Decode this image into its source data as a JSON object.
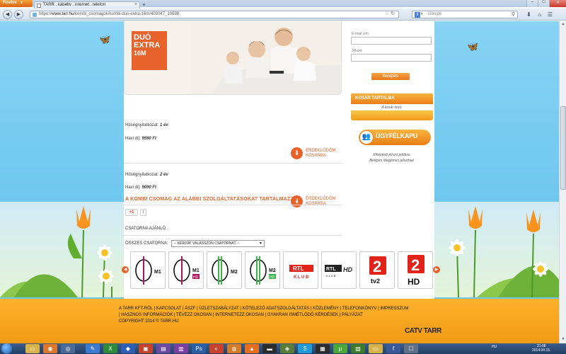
{
  "browser": {
    "menu_label": "Firefox",
    "tab_title": "TARR . kábeltv . internet . telefon",
    "url_host": "www.tarr.hu",
    "url_prefix": "https://",
    "url_path": "/kombi_csomagok/kombi-duo-extra-16m/400047_10598",
    "search_placeholder": "Google"
  },
  "hero": {
    "badge_line1": "DUÓ",
    "badge_line2": "EXTRA",
    "badge_line3": "16M"
  },
  "offers": [
    {
      "commitment_label": "Hűségnyilatkozat:",
      "commitment_value": "1 év",
      "fee_label": "Havi díj:",
      "fee_value": "9590 Ft",
      "cta_line1": "ÉRDEKLŐDÖM",
      "cta_line2": "KOSÁRBA"
    },
    {
      "commitment_label": "Hűségnyilatkozat:",
      "commitment_value": "2 év",
      "fee_label": "Havi díj:",
      "fee_value": "9090 Ft",
      "cta_line1": "ÉRDEKLŐDÖM",
      "cta_line2": "KOSÁRBA"
    }
  ],
  "login": {
    "email_label": "E-mail cím:",
    "password_label": "Jelszó:",
    "submit_label": "Belépés"
  },
  "cart": {
    "title": "KOSÁR TARTALMA",
    "empty_text": "A kosár üres."
  },
  "customer_portal": {
    "label": "ÜGYFÉLKAPU",
    "note_line1": "Elfelejtett jelszó pótlása",
    "note_line2": "Belépés ideiglenes jelszóval"
  },
  "package": {
    "section_title": "A KOMBI CSOMAG AZ ALÁBBI SZOLGÁLTATÁSOKAT TARTALMAZZA",
    "gplus_label": "+1",
    "gplus_count": "1",
    "channel_recommend": "CSATORNA AJÁNLÓ",
    "all_channels_label": "ÖSSZES CSATORNA:",
    "channel_select_value": "-- KÉRJÜK VÁLASSZON CSATORNÁT --"
  },
  "channels": [
    {
      "name": "M1",
      "badge": "",
      "color": "#b0125b"
    },
    {
      "name": "M1",
      "badge": "HD",
      "color": "#b0125b"
    },
    {
      "name": "M2",
      "badge": "",
      "color": "#3bb54a"
    },
    {
      "name": "M2",
      "badge": "HD",
      "color": "#3bb54a"
    },
    {
      "name": "RTL",
      "badge": "KLUB",
      "color": "#e2231a"
    },
    {
      "name": "RTL",
      "badge": "HD",
      "color": "#222222"
    },
    {
      "name": "tv2",
      "badge": "",
      "color": "#e2231a"
    },
    {
      "name": "2",
      "badge": "HD",
      "color": "#e2231a"
    }
  ],
  "footer": {
    "line1": "A TARR KFT-RŐL | KAPCSOLAT | ÁSZF | ÜZLETSZABÁLYZAT | KÖTELEZŐ ADATSZOLGÁLTATÁS | KÖZLEMÉNY | TELEFONKÖNYV | IMPRESSZUM",
    "line2": "| HASZNOS INFORMÁCIÓK | TÉVÉZZ OKOSAN | INTERNETEZZ OKOSAN | GYAKRAN ISMÉTLŐDŐ KÉRDÉSEK | PÁLYÁZAT",
    "copyright": "COPYRIGHT 2014 © TARR.HU",
    "logo": "CATV TARR"
  },
  "taskbar": {
    "language": "HU",
    "time": "21:08",
    "date": "2014.04.15."
  },
  "colors": {
    "accent": "#e8632c",
    "sky": "#6dc6ef",
    "footer": "#f7a51f"
  }
}
